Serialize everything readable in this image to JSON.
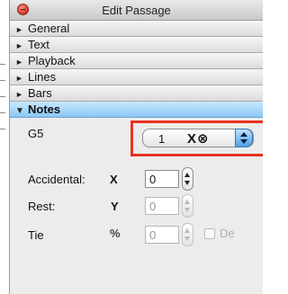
{
  "window": {
    "title": "Edit Passage"
  },
  "sections": [
    {
      "label": "General",
      "expanded": false
    },
    {
      "label": "Text",
      "expanded": false
    },
    {
      "label": "Playback",
      "expanded": false
    },
    {
      "label": "Lines",
      "expanded": false
    },
    {
      "label": "Bars",
      "expanded": false
    },
    {
      "label": "Notes",
      "expanded": true
    }
  ],
  "notes": {
    "pitch_label": "G5",
    "pitch_control": {
      "value": "1",
      "symbol": "X⊗"
    },
    "accidental": {
      "label": "Accidental:",
      "axis": "X",
      "value": "0"
    },
    "rest": {
      "label": "Rest:",
      "axis": "Y",
      "value": "0"
    },
    "tie": {
      "label": "Tie",
      "axis": "%",
      "value": "0",
      "checkbox_label": "De"
    }
  },
  "colors": {
    "highlight_border": "#e8321f",
    "expanded_header": "#8cc8f5",
    "close_button": "#e0412f"
  }
}
